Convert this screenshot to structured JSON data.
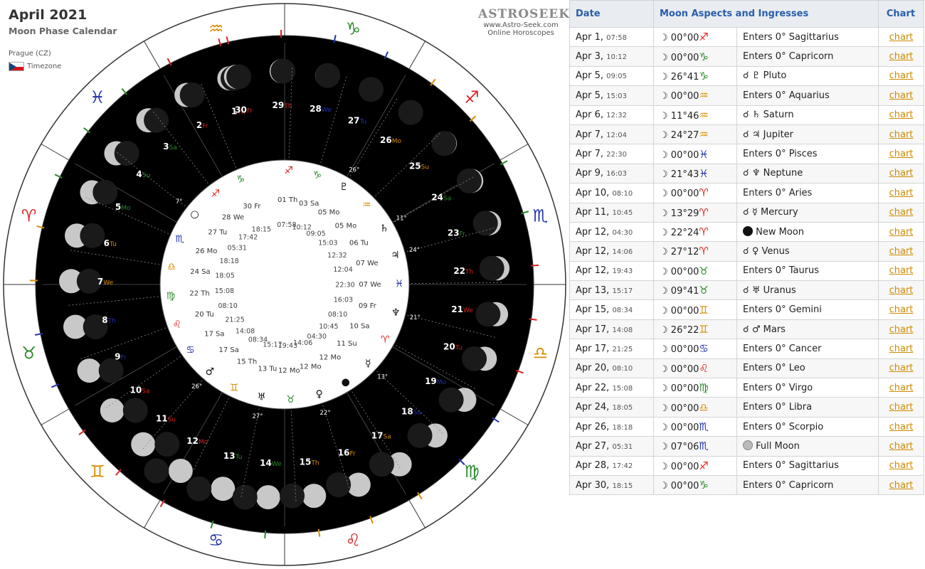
{
  "header": {
    "title": "April 2021",
    "subtitle": "Moon Phase Calendar",
    "location": "Prague (CZ)",
    "timezone_label": "Timezone"
  },
  "brand": {
    "logo": "ASTROSEEK",
    "url": "www.Astro-Seek.com",
    "tagline": "Online Horoscopes"
  },
  "wheel": {
    "outer_signs": [
      {
        "glyph": "♑",
        "name": "capricorn",
        "color": "#2c8a2c"
      },
      {
        "glyph": "♐",
        "name": "sagittarius",
        "color": "#dd2222"
      },
      {
        "glyph": "♏",
        "name": "scorpio",
        "color": "#2233aa"
      },
      {
        "glyph": "♎",
        "name": "libra",
        "color": "#d88c00"
      },
      {
        "glyph": "♍",
        "name": "virgo",
        "color": "#2c8a2c"
      },
      {
        "glyph": "♌",
        "name": "leo",
        "color": "#dd2222"
      },
      {
        "glyph": "♋",
        "name": "cancer",
        "color": "#2233aa"
      },
      {
        "glyph": "♊",
        "name": "gemini",
        "color": "#d88c00"
      },
      {
        "glyph": "♉",
        "name": "taurus",
        "color": "#2c8a2c"
      },
      {
        "glyph": "♈",
        "name": "aries",
        "color": "#dd2222"
      },
      {
        "glyph": "♓",
        "name": "pisces",
        "color": "#2233aa"
      },
      {
        "glyph": "♒",
        "name": "aquarius",
        "color": "#d88c00"
      }
    ],
    "day_labels": [
      {
        "d": "1",
        "w": "Th",
        "wc": "#dd2222"
      },
      {
        "d": "2",
        "w": "Fr",
        "wc": "#dd2222"
      },
      {
        "d": "3",
        "w": "Sa",
        "wc": "#2c8a2c"
      },
      {
        "d": "4",
        "w": "Su",
        "wc": "#2c8a2c"
      },
      {
        "d": "5",
        "w": "Mo",
        "wc": "#2c8a2c"
      },
      {
        "d": "6",
        "w": "Tu",
        "wc": "#d88c00"
      },
      {
        "d": "7",
        "w": "We",
        "wc": "#d88c00"
      },
      {
        "d": "8",
        "w": "Th",
        "wc": "#2233aa"
      },
      {
        "d": "9",
        "w": "Fr",
        "wc": "#2233aa"
      },
      {
        "d": "10",
        "w": "Sa",
        "wc": "#dd2222"
      },
      {
        "d": "11",
        "w": "Su",
        "wc": "#dd2222"
      },
      {
        "d": "12",
        "w": "Mo",
        "wc": "#dd2222"
      },
      {
        "d": "13",
        "w": "Tu",
        "wc": "#2c8a2c"
      },
      {
        "d": "14",
        "w": "We",
        "wc": "#2c8a2c"
      },
      {
        "d": "15",
        "w": "Th",
        "wc": "#d88c00"
      },
      {
        "d": "16",
        "w": "Fr",
        "wc": "#d88c00"
      },
      {
        "d": "17",
        "w": "Sa",
        "wc": "#d88c00"
      },
      {
        "d": "18",
        "w": "Su",
        "wc": "#2233aa"
      },
      {
        "d": "19",
        "w": "Mo",
        "wc": "#2233aa"
      },
      {
        "d": "20",
        "w": "Tu",
        "wc": "#dd2222"
      },
      {
        "d": "21",
        "w": "We",
        "wc": "#dd2222"
      },
      {
        "d": "22",
        "w": "Th",
        "wc": "#dd2222"
      },
      {
        "d": "23",
        "w": "Fr",
        "wc": "#2c8a2c"
      },
      {
        "d": "24",
        "w": "Sa",
        "wc": "#2c8a2c"
      },
      {
        "d": "25",
        "w": "Su",
        "wc": "#d88c00"
      },
      {
        "d": "26",
        "w": "Mo",
        "wc": "#d88c00"
      },
      {
        "d": "27",
        "w": "Tu",
        "wc": "#2233aa"
      },
      {
        "d": "28",
        "w": "We",
        "wc": "#2233aa"
      },
      {
        "d": "29",
        "w": "Th",
        "wc": "#dd2222"
      },
      {
        "d": "30",
        "w": "Fr",
        "wc": "#dd2222"
      }
    ],
    "outer_ring_labels": [
      {
        "text": "30 Fr",
        "sub": "18:15"
      },
      {
        "text": "28 We",
        "sub": "17:42"
      }
    ],
    "inner_events": [
      {
        "date": "01 Th",
        "time": "07:58",
        "sign": "♐",
        "color": "#dd2222"
      },
      {
        "date": "03 Sa",
        "time": "10:12",
        "sign": "♑",
        "color": "#2c8a2c"
      },
      {
        "date": "05 Mo",
        "time": "09:05",
        "planet": "♇",
        "deg": "26°"
      },
      {
        "date": "05 Mo",
        "time": "15:03",
        "sign": "♒",
        "color": "#d88c00"
      },
      {
        "date": "06 Tu",
        "time": "12:32",
        "planet": "♄",
        "deg": "11°"
      },
      {
        "date": "07 We",
        "time": "12:04",
        "planet": "♃",
        "deg": "24°"
      },
      {
        "date": "07 We",
        "time": "22:30",
        "sign": "♓",
        "color": "#2233aa"
      },
      {
        "date": "09 Fr",
        "time": "16:03",
        "planet": "♆",
        "deg": "21°"
      },
      {
        "date": "10 Sa",
        "time": "08:10",
        "sign": "♈",
        "color": "#dd2222"
      },
      {
        "date": "11 Su",
        "time": "10:45",
        "planet": "☿",
        "deg": "13°"
      },
      {
        "date": "12 Mo",
        "time": "04:30",
        "planet": "●",
        "deg": ""
      },
      {
        "date": "12 Mo",
        "time": "14:06",
        "planet": "♀",
        "deg": "22°"
      },
      {
        "date": "12 Mo",
        "time": "19:43",
        "sign": "♉",
        "color": "#2c8a2c"
      },
      {
        "date": "13 Tu",
        "time": "15:17",
        "planet": "♅",
        "deg": "27°"
      },
      {
        "date": "15 Th",
        "time": "08:34",
        "sign": "♊",
        "color": "#d88c00"
      },
      {
        "date": "17 Sa",
        "time": "14:08",
        "planet": "♂",
        "deg": "26°"
      },
      {
        "date": "17 Sa",
        "time": "21:25",
        "sign": "♋",
        "color": "#2233aa"
      },
      {
        "date": "20 Tu",
        "time": "08:10",
        "sign": "♌",
        "color": "#dd2222"
      },
      {
        "date": "22 Th",
        "time": "15:08",
        "sign": "♍",
        "color": "#2c8a2c"
      },
      {
        "date": "24 Sa",
        "time": "18:05",
        "sign": "♎",
        "color": "#d88c00"
      },
      {
        "date": "26 Mo",
        "time": "18:18",
        "sign": "♏",
        "color": "#2233aa"
      },
      {
        "date": "27 Tu",
        "time": "05:31",
        "planet": "○",
        "deg": "7°"
      },
      {
        "date": "28 We",
        "time": "17:42",
        "sign": "♐",
        "color": "#dd2222"
      },
      {
        "date": "30 Fr",
        "time": "18:15",
        "sign": "♑",
        "color": "#2c8a2c"
      }
    ],
    "degree_marks": [
      "26°",
      "11°",
      "24°",
      "21°",
      "13°",
      "22°",
      "27°",
      "9°",
      "26°",
      "7°"
    ],
    "colors": {
      "night": "#000000",
      "ring": "#ffffff",
      "moon": "#c8c8c8",
      "shadow": "#1a1a1a"
    }
  },
  "table": {
    "headers": [
      "Date",
      "Moon Aspects and Ingresses",
      "Chart"
    ],
    "rows": [
      {
        "date": "Apr 1,",
        "time": "07:58",
        "pos": "00°00",
        "sign": "♐",
        "sc": "#dd2222",
        "event": "Enters 0° Sagittarius",
        "link": "chart"
      },
      {
        "date": "Apr 3,",
        "time": "10:12",
        "pos": "00°00",
        "sign": "♑",
        "sc": "#2c8a2c",
        "event": "Enters 0° Capricorn",
        "link": "chart"
      },
      {
        "date": "Apr 5,",
        "time": "09:05",
        "pos": "26°41",
        "sign": "♑",
        "sc": "#2c8a2c",
        "event": "☌ ♇ Pluto",
        "link": "chart"
      },
      {
        "date": "Apr 5,",
        "time": "15:03",
        "pos": "00°00",
        "sign": "♒",
        "sc": "#d88c00",
        "event": "Enters 0° Aquarius",
        "link": "chart"
      },
      {
        "date": "Apr 6,",
        "time": "12:32",
        "pos": "11°46",
        "sign": "♒",
        "sc": "#d88c00",
        "event": "☌ ♄ Saturn",
        "link": "chart"
      },
      {
        "date": "Apr 7,",
        "time": "12:04",
        "pos": "24°27",
        "sign": "♒",
        "sc": "#d88c00",
        "event": "☌ ♃ Jupiter",
        "link": "chart"
      },
      {
        "date": "Apr 7,",
        "time": "22:30",
        "pos": "00°00",
        "sign": "♓",
        "sc": "#2233aa",
        "event": "Enters 0° Pisces",
        "link": "chart"
      },
      {
        "date": "Apr 9,",
        "time": "16:03",
        "pos": "21°43",
        "sign": "♓",
        "sc": "#2233aa",
        "event": "☌ ♆ Neptune",
        "link": "chart"
      },
      {
        "date": "Apr 10,",
        "time": "08:10",
        "pos": "00°00",
        "sign": "♈",
        "sc": "#dd2222",
        "event": "Enters 0° Aries",
        "link": "chart"
      },
      {
        "date": "Apr 11,",
        "time": "10:45",
        "pos": "13°29",
        "sign": "♈",
        "sc": "#dd2222",
        "event": "☌ ☿ Mercury",
        "link": "chart"
      },
      {
        "date": "Apr 12,",
        "time": "04:30",
        "pos": "22°24",
        "sign": "♈",
        "sc": "#dd2222",
        "event": "New Moon",
        "phase": "new",
        "link": "chart"
      },
      {
        "date": "Apr 12,",
        "time": "14:06",
        "pos": "27°12",
        "sign": "♈",
        "sc": "#dd2222",
        "event": "☌ ♀ Venus",
        "link": "chart"
      },
      {
        "date": "Apr 12,",
        "time": "19:43",
        "pos": "00°00",
        "sign": "♉",
        "sc": "#2c8a2c",
        "event": "Enters 0° Taurus",
        "link": "chart"
      },
      {
        "date": "Apr 13,",
        "time": "15:17",
        "pos": "09°41",
        "sign": "♉",
        "sc": "#2c8a2c",
        "event": "☌ ♅ Uranus",
        "link": "chart"
      },
      {
        "date": "Apr 15,",
        "time": "08:34",
        "pos": "00°00",
        "sign": "♊",
        "sc": "#d88c00",
        "event": "Enters 0° Gemini",
        "link": "chart"
      },
      {
        "date": "Apr 17,",
        "time": "14:08",
        "pos": "26°22",
        "sign": "♊",
        "sc": "#d88c00",
        "event": "☌ ♂ Mars",
        "link": "chart"
      },
      {
        "date": "Apr 17,",
        "time": "21:25",
        "pos": "00°00",
        "sign": "♋",
        "sc": "#2233aa",
        "event": "Enters 0° Cancer",
        "link": "chart"
      },
      {
        "date": "Apr 20,",
        "time": "08:10",
        "pos": "00°00",
        "sign": "♌",
        "sc": "#dd2222",
        "event": "Enters 0° Leo",
        "link": "chart"
      },
      {
        "date": "Apr 22,",
        "time": "15:08",
        "pos": "00°00",
        "sign": "♍",
        "sc": "#2c8a2c",
        "event": "Enters 0° Virgo",
        "link": "chart"
      },
      {
        "date": "Apr 24,",
        "time": "18:05",
        "pos": "00°00",
        "sign": "♎",
        "sc": "#d88c00",
        "event": "Enters 0° Libra",
        "link": "chart"
      },
      {
        "date": "Apr 26,",
        "time": "18:18",
        "pos": "00°00",
        "sign": "♏",
        "sc": "#2233aa",
        "event": "Enters 0° Scorpio",
        "link": "chart"
      },
      {
        "date": "Apr 27,",
        "time": "05:31",
        "pos": "07°06",
        "sign": "♏",
        "sc": "#2233aa",
        "event": "Full Moon",
        "phase": "full",
        "link": "chart"
      },
      {
        "date": "Apr 28,",
        "time": "17:42",
        "pos": "00°00",
        "sign": "♐",
        "sc": "#dd2222",
        "event": "Enters 0° Sagittarius",
        "link": "chart"
      },
      {
        "date": "Apr 30,",
        "time": "18:15",
        "pos": "00°00",
        "sign": "♑",
        "sc": "#2c8a2c",
        "event": "Enters 0° Capricorn",
        "link": "chart"
      }
    ]
  }
}
